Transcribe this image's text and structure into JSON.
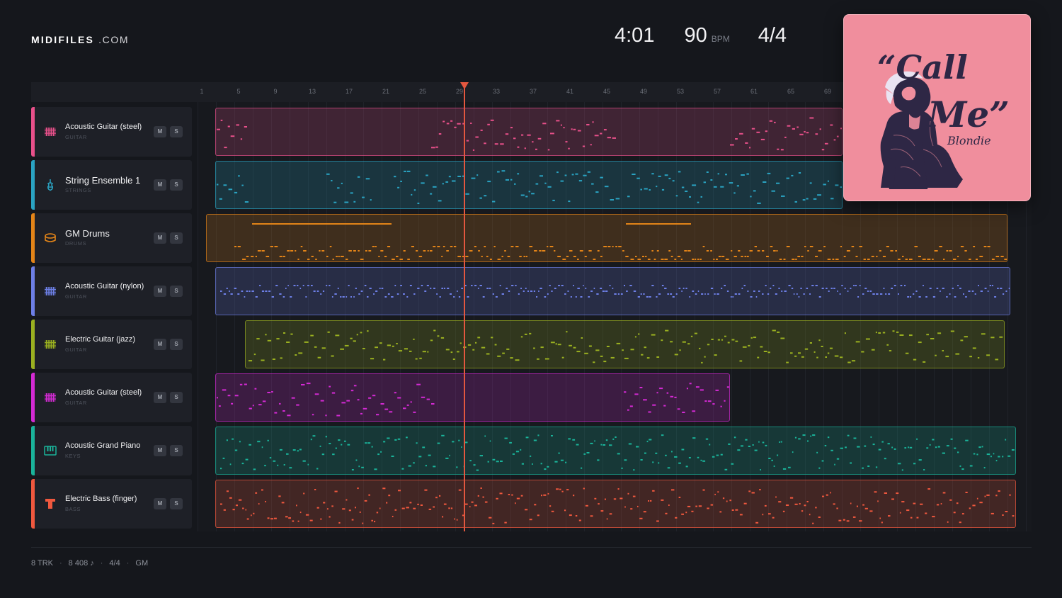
{
  "brand": {
    "name": "MIDIFILES",
    "suffix": ".COM"
  },
  "stats": {
    "duration": "4:01",
    "bpm": "90",
    "bpm_unit": "BPM",
    "time_signature": "4/4"
  },
  "cover": {
    "title": "“Call Me”",
    "artist": "Blondie",
    "bg_color": "#f08e9d",
    "ink_color": "#2e2745"
  },
  "ruler": {
    "bars": [
      "1",
      "5",
      "9",
      "13",
      "17",
      "21",
      "25",
      "29",
      "33",
      "37",
      "41",
      "45",
      "49",
      "53",
      "57",
      "61",
      "65",
      "69"
    ]
  },
  "playhead": {
    "bar": "29"
  },
  "tracks": [
    {
      "name": "Acoustic Guitar (steel)",
      "category": "GUITAR",
      "color": "#e8508a",
      "icon": "guitar-icon",
      "mute": "M",
      "solo": "S"
    },
    {
      "name": "String Ensemble 1",
      "category": "STRINGS",
      "color": "#2aa3c2",
      "icon": "violin-icon",
      "mute": "M",
      "solo": "S"
    },
    {
      "name": "GM Drums",
      "category": "DRUMS",
      "color": "#e38418",
      "icon": "drum-icon",
      "mute": "M",
      "solo": "S"
    },
    {
      "name": "Acoustic Guitar (nylon)",
      "category": "GUITAR",
      "color": "#6d7fe6",
      "icon": "guitar-icon",
      "mute": "M",
      "solo": "S"
    },
    {
      "name": "Electric Guitar (jazz)",
      "category": "GUITAR",
      "color": "#9ab020",
      "icon": "guitar-icon",
      "mute": "M",
      "solo": "S"
    },
    {
      "name": "Acoustic Guitar (steel)",
      "category": "GUITAR",
      "color": "#d42ad4",
      "icon": "guitar-icon",
      "mute": "M",
      "solo": "S"
    },
    {
      "name": "Acoustic Grand Piano",
      "category": "KEYS",
      "color": "#1ab39a",
      "icon": "piano-icon",
      "mute": "M",
      "solo": "S"
    },
    {
      "name": "Electric Bass (finger)",
      "category": "BASS",
      "color": "#f0583e",
      "icon": "bass-icon",
      "mute": "M",
      "solo": "S"
    }
  ],
  "footer": {
    "tracks": "8 TRK",
    "notes": "8 408 ♪",
    "time_signature": "4/4",
    "standard": "GM"
  }
}
